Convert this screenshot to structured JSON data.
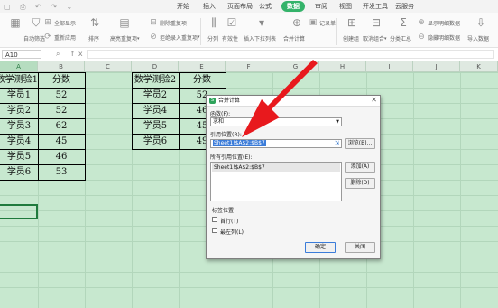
{
  "menu": {
    "tabs": [
      {
        "label": "开始"
      },
      {
        "label": "插入"
      },
      {
        "label": "页面布局"
      },
      {
        "label": "公式"
      },
      {
        "label": "数据"
      },
      {
        "label": "审阅"
      },
      {
        "label": "视图"
      },
      {
        "label": "开发工具"
      },
      {
        "label": "云服务"
      }
    ],
    "active_tab": "数据"
  },
  "ribbon": {
    "show_all": "全部显示",
    "reapply": "重新应用",
    "auto_filter": "自动筛选",
    "sort": "排序",
    "highlight_duplicates": "高亮重复项",
    "delete_duplicates": "删除重复项",
    "reject_duplicates": "拒绝录入重复项",
    "split": "分列",
    "validity": "有效性",
    "insert_dropdown": "插入下拉列表",
    "consolidate": "合并计算",
    "record_form": "记录单",
    "create_group": "创建组",
    "ungroup": "取消组合",
    "subtotal": "分类汇总",
    "show_detail": "显示明细数据",
    "hide_detail": "隐藏明细数据",
    "import_data": "导入数据"
  },
  "formula_bar": {
    "name_box": "A10",
    "formula": ""
  },
  "columns": [
    "A",
    "B",
    "C",
    "D",
    "E",
    "F",
    "G",
    "H",
    "I",
    "J",
    "K"
  ],
  "table1": {
    "header": [
      "数学测验1",
      "分数"
    ],
    "rows": [
      [
        "学员1",
        "52"
      ],
      [
        "学员2",
        "52"
      ],
      [
        "学员3",
        "62"
      ],
      [
        "学员4",
        "45"
      ],
      [
        "学员5",
        "46"
      ],
      [
        "学员6",
        "53"
      ]
    ]
  },
  "table2": {
    "header": [
      "数学测验2",
      "分数"
    ],
    "rows": [
      [
        "学员2",
        "52"
      ],
      [
        "学员4",
        "46"
      ],
      [
        "学员5",
        "45"
      ],
      [
        "学员6",
        "49"
      ]
    ]
  },
  "dialog": {
    "title": "合并计算",
    "function_label": "函数(F):",
    "function_value": "求和",
    "reference_label": "引用位置(R):",
    "reference_value": "Sheet1!$A$2:$B$7",
    "browse_button": "浏览(B)...",
    "all_references_label": "所有引用位置(E):",
    "all_references": [
      "Sheet1!$A$2:$B$7"
    ],
    "add_button": "添加(A)",
    "delete_button": "删除(D)",
    "label_position_title": "标签位置",
    "first_row_label": "首行(T)",
    "left_column_label": "最左列(L)",
    "ok_button": "确定",
    "close_button": "关闭"
  },
  "colors": {
    "accent": "#34b36a",
    "grid_background": "#c7e8cf",
    "arrow": "#e8191d",
    "selection_highlight": "#3b7cd9"
  }
}
